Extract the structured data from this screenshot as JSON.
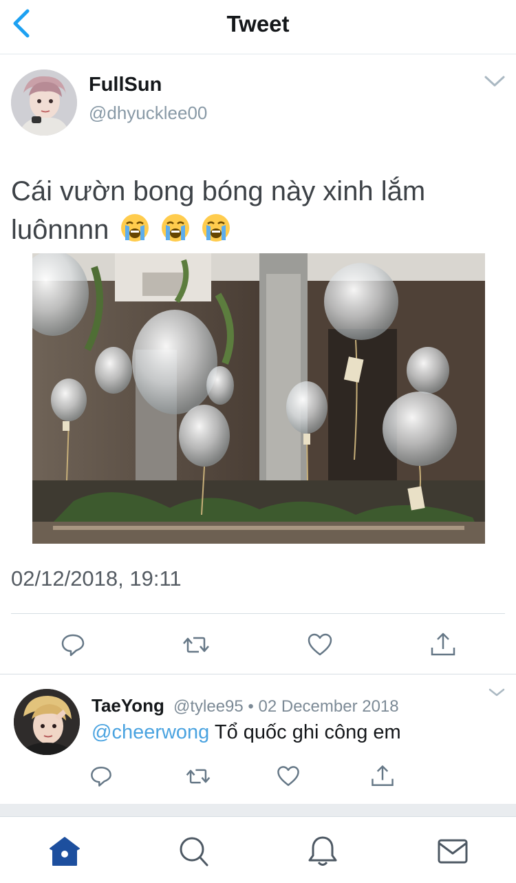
{
  "header": {
    "title": "Tweet",
    "back_icon": "chevron-left-icon",
    "accent": "#1da1f2"
  },
  "tweet": {
    "author_name": "FullSun",
    "author_handle": "@dhyucklee00",
    "text_line1": "Cái vườn bong bóng này xinh lắm",
    "text_line2": "luônnnn",
    "emoji": [
      "loudly-crying-face",
      "loudly-crying-face",
      "loudly-crying-face"
    ],
    "media_description": "photo",
    "timestamp": "02/12/2018, 19:11",
    "actions": [
      "reply-icon",
      "retweet-icon",
      "like-icon",
      "share-icon"
    ]
  },
  "reply": {
    "author_name": "TaeYong",
    "author_handle": "@tylee95",
    "meta": "@tylee95 • 02 December 2018",
    "mention": "@cheerwong",
    "text": "Tổ quốc ghi công em",
    "mention_color": "#4aa3e0",
    "actions": [
      "reply-icon",
      "retweet-icon",
      "like-icon",
      "share-icon"
    ]
  },
  "tabbar": {
    "items": [
      "home-icon",
      "search-icon",
      "notifications-icon",
      "messages-icon"
    ],
    "active": "home-icon",
    "active_color": "#1d4f9e"
  }
}
